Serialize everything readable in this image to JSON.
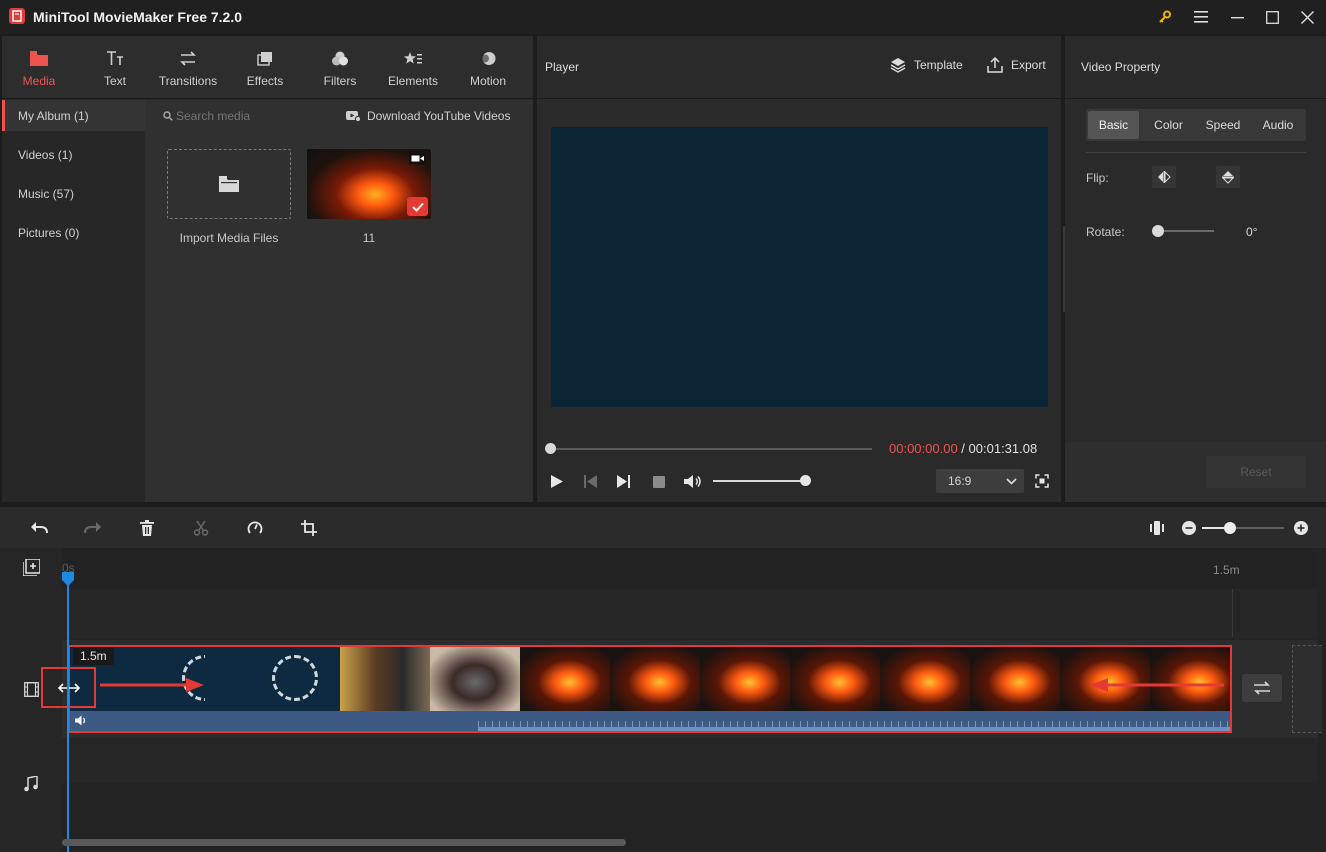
{
  "app": {
    "title": "MiniTool MovieMaker Free 7.2.0"
  },
  "media_tabs": [
    {
      "label": "Media",
      "icon": "folder-icon"
    },
    {
      "label": "Text",
      "icon": "text-icon"
    },
    {
      "label": "Transitions",
      "icon": "transitions-icon"
    },
    {
      "label": "Effects",
      "icon": "effects-icon"
    },
    {
      "label": "Filters",
      "icon": "filters-icon"
    },
    {
      "label": "Elements",
      "icon": "elements-icon"
    },
    {
      "label": "Motion",
      "icon": "motion-icon"
    }
  ],
  "album": {
    "items": [
      {
        "label": "My Album (1)"
      },
      {
        "label": "Videos (1)"
      },
      {
        "label": "Music (57)"
      },
      {
        "label": "Pictures (0)"
      }
    ]
  },
  "media": {
    "search_placeholder": "Search media",
    "download_label": "Download YouTube Videos",
    "import_label": "Import Media Files",
    "clip_name": "11"
  },
  "player": {
    "title": "Player",
    "template_label": "Template",
    "export_label": "Export",
    "current_time": "00:00:00.00",
    "separator": " / ",
    "total_time": "00:01:31.08",
    "aspect_ratio": "16:9",
    "progress": 0,
    "volume": 0.98
  },
  "property": {
    "title": "Video Property",
    "tabs": [
      "Basic",
      "Color",
      "Speed",
      "Audio"
    ],
    "flip_label": "Flip:",
    "rotate_label": "Rotate:",
    "rotate_value": "0°",
    "reset_label": "Reset"
  },
  "timeline": {
    "ruler_start": "0s",
    "ruler_end": "1.5m",
    "clip_duration_tooltip": "1.5m",
    "zoom": 0.3
  },
  "colors": {
    "accent": "#ef5350",
    "playhead": "#1e88e5",
    "preview_bg": "#0b2536",
    "audio_wave": "#3f5f8a"
  }
}
